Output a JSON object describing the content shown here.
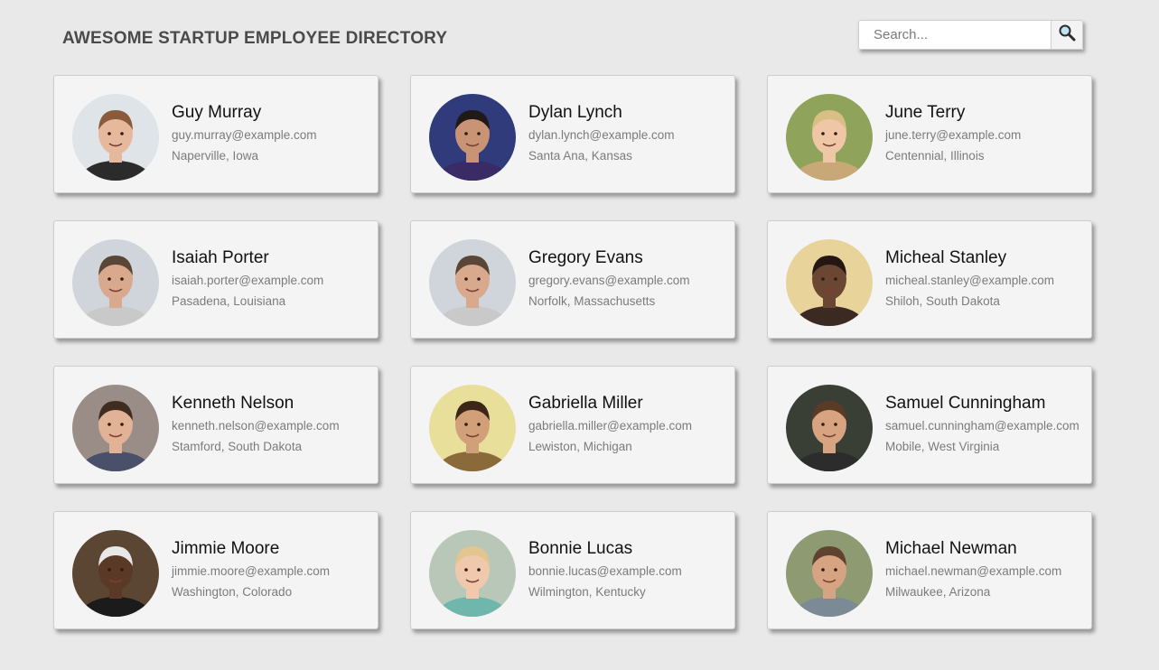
{
  "header": {
    "title": "AWESOME STARTUP EMPLOYEE DIRECTORY"
  },
  "search": {
    "placeholder": "Search...",
    "value": "",
    "button_icon": "search-icon"
  },
  "employees": [
    {
      "name": "Guy Murray",
      "email": "guy.murray@example.com",
      "location": "Naperville, Iowa",
      "bg": "#dfe4e8",
      "skin": "#e6b89c",
      "hair": "#8a5a3a",
      "shirt": "#2b2b2b"
    },
    {
      "name": "Dylan Lynch",
      "email": "dylan.lynch@example.com",
      "location": "Santa Ana, Kansas",
      "bg": "#2f3b7a",
      "skin": "#c99476",
      "hair": "#1f1a17",
      "shirt": "#3a2a66"
    },
    {
      "name": "June Terry",
      "email": "june.terry@example.com",
      "location": "Centennial, Illinois",
      "bg": "#8fa35a",
      "skin": "#efc7a6",
      "hair": "#d8bf84",
      "shirt": "#c9a878"
    },
    {
      "name": "Isaiah Porter",
      "email": "isaiah.porter@example.com",
      "location": "Pasadena, Louisiana",
      "bg": "#cfd5da",
      "skin": "#d9a98d",
      "hair": "#5a4636",
      "shirt": "#c9c9c9"
    },
    {
      "name": "Gregory Evans",
      "email": "gregory.evans@example.com",
      "location": "Norfolk, Massachusetts",
      "bg": "#cfd5da",
      "skin": "#d9a98d",
      "hair": "#5a4636",
      "shirt": "#c9c9c9"
    },
    {
      "name": "Micheal Stanley",
      "email": "micheal.stanley@example.com",
      "location": "Shiloh, South Dakota",
      "bg": "#e8d49a",
      "skin": "#6b4632",
      "hair": "#241712",
      "shirt": "#3b2a22"
    },
    {
      "name": "Kenneth Nelson",
      "email": "kenneth.nelson@example.com",
      "location": "Stamford, South Dakota",
      "bg": "#9a8c86",
      "skin": "#e2b296",
      "hair": "#3f2d22",
      "shirt": "#4a4f6a"
    },
    {
      "name": "Gabriella Miller",
      "email": "gabriella.miller@example.com",
      "location": "Lewiston, Michigan",
      "bg": "#e8df9b",
      "skin": "#d1a078",
      "hair": "#3b2618",
      "shirt": "#8a6a3a"
    },
    {
      "name": "Samuel Cunningham",
      "email": "samuel.cunningham@example.com",
      "location": "Mobile, West Virginia",
      "bg": "#3a3f35",
      "skin": "#d8a381",
      "hair": "#5a3b25",
      "shirt": "#2c2c2c"
    },
    {
      "name": "Jimmie Moore",
      "email": "jimmie.moore@example.com",
      "location": "Washington, Colorado",
      "bg": "#5a4632",
      "skin": "#5a3a27",
      "hair": "#e8e8e8",
      "shirt": "#1b1b1b"
    },
    {
      "name": "Bonnie Lucas",
      "email": "bonnie.lucas@example.com",
      "location": "Wilmington, Kentucky",
      "bg": "#b9c7b8",
      "skin": "#f0c9ad",
      "hair": "#e2c58f",
      "shirt": "#6fb6ad"
    },
    {
      "name": "Michael Newman",
      "email": "michael.newman@example.com",
      "location": "Milwaukee, Arizona",
      "bg": "#8e9a72",
      "skin": "#d7a483",
      "hair": "#5d4330",
      "shirt": "#7c8a96"
    }
  ]
}
